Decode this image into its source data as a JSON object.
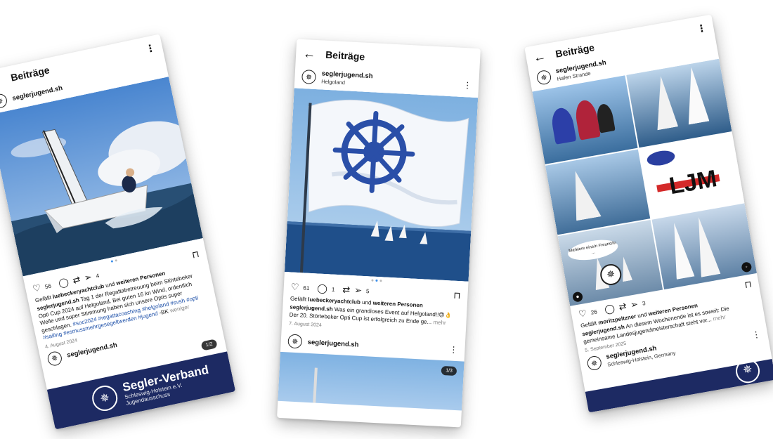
{
  "post1": {
    "header_title": "Beiträge",
    "username": "seglerjugend.sh",
    "likes_count": "56",
    "shares_count": "4",
    "liked_by_user": "luebeckeryachtclub",
    "liked_by_prefix": "Gefällt",
    "liked_by_middle": "und",
    "liked_by_suffix": "weiteren Personen",
    "caption_user": "seglerjugend.sh",
    "caption_text": "Tag 1 der Regattabetreuung beim Störtebeker Opti Cup 2024 auf Helgoland. Bei guten 16 kn Wind, ordentlich Welle und super Stimmung haben sich unsere Optis super geschlagen.",
    "hashtags": "#soc2024 #regattacoaching #helgoland #svsh #opti #sailing #esmussmehrgesegeltwerden #jugend",
    "signature": "-BK",
    "less_link": "weniger",
    "date": "4. August 2024",
    "next_username": "seglerjugend.sh",
    "counter": "1/2",
    "banner_title": "Segler-Verband",
    "banner_sub1": "Schleswig-Holstein e.V.",
    "banner_sub2": "Jugendausschuss"
  },
  "post2": {
    "header_title": "Beiträge",
    "username": "seglerjugend.sh",
    "location": "Helgoland",
    "likes_count": "61",
    "comments_count": "1",
    "shares_count": "5",
    "liked_by_prefix": "Gefällt",
    "liked_by_user": "luebeckeryachtclub",
    "liked_by_middle": "und",
    "liked_by_suffix": "weiteren Personen",
    "caption_user": "seglerjugend.sh",
    "caption_text": "Was ein grandioses Event auf Helgoland!!😍👌 Der 20. Störtebeker Opti Cup ist erfolgreich zu Ende ge...",
    "more_link": "mehr",
    "date": "7. August 2024",
    "next_username": "seglerjugend.sh",
    "counter": "1/3"
  },
  "post3": {
    "header_title": "Beiträge",
    "username": "seglerjugend.sh",
    "location": "Hafen Strande",
    "tag_prompt": "Markiere eine/n Freund/in ...",
    "likes_count": "26",
    "shares_count": "3",
    "liked_by_prefix": "Gefällt",
    "liked_by_user": "moritzpeltzner",
    "liked_by_middle": "und",
    "liked_by_suffix": "weiteren Personen",
    "caption_user": "seglerjugend.sh",
    "caption_text": "An diesem Wochenende ist es soweit: Die gemeinsame Landesjugendmeisterschaft steht vor...",
    "more_link": "mehr",
    "date": "5. September 2025",
    "next_username": "seglerjugend.sh",
    "next_location": "Schleswig-Holstein, Germany",
    "ljm_logo": "LJM"
  },
  "colors": {
    "hashtag": "#1c4fa8",
    "banner": "#1d2a63",
    "flag_emblem": "#2a4fa8",
    "sky": "#6fa8dc",
    "sea": "#1f4f8a"
  }
}
